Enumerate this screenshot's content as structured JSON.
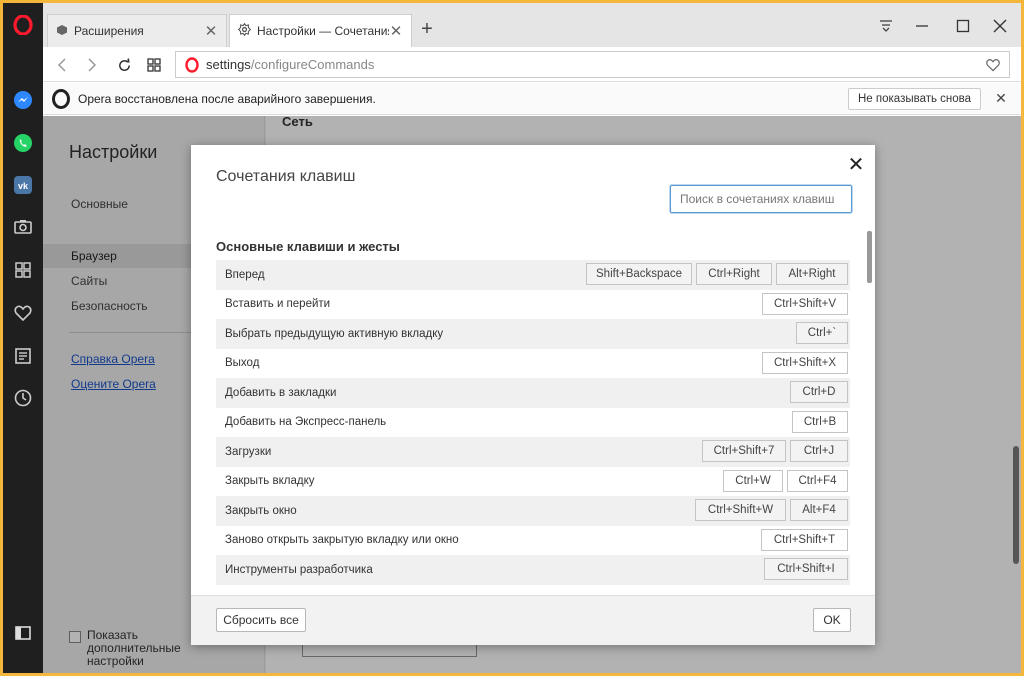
{
  "tabs": [
    {
      "label": "Расширения",
      "icon": "extensions-cube-icon",
      "active": false
    },
    {
      "label": "Настройки — Сочетания",
      "icon": "gear-icon",
      "active": true
    }
  ],
  "address": {
    "host": "settings",
    "path": "/configureCommands"
  },
  "infobar": {
    "text": "Opera восстановлена после аварийного завершения.",
    "dismiss_label": "Не показывать снова"
  },
  "settings": {
    "title": "Настройки",
    "nav": [
      "Основные",
      "Браузер",
      "Сайты",
      "Безопасность"
    ],
    "selected": "Браузер",
    "links": [
      "Справка Opera",
      "Оцените Opera"
    ],
    "advanced_label": "Показать дополнительные настройки",
    "section_network": "Сеть"
  },
  "dialog": {
    "title": "Сочетания клавиш",
    "search_placeholder": "Поиск в сочетаниях клавиш",
    "section": "Основные клавиши и жесты",
    "shortcuts": [
      {
        "action": "Вперед",
        "keys": [
          "Shift+Backspace",
          "Ctrl+Right",
          "Alt+Right"
        ]
      },
      {
        "action": "Вставить и перейти",
        "keys": [
          "Ctrl+Shift+V"
        ]
      },
      {
        "action": "Выбрать предыдущую активную вкладку",
        "keys": [
          "Ctrl+`"
        ]
      },
      {
        "action": "Выход",
        "keys": [
          "Ctrl+Shift+X"
        ]
      },
      {
        "action": "Добавить в закладки",
        "keys": [
          "Ctrl+D"
        ]
      },
      {
        "action": "Добавить на Экспресс-панель",
        "keys": [
          "Ctrl+B"
        ]
      },
      {
        "action": "Загрузки",
        "keys": [
          "Ctrl+Shift+7",
          "Ctrl+J"
        ]
      },
      {
        "action": "Закрыть вкладку",
        "keys": [
          "Ctrl+W",
          "Ctrl+F4"
        ]
      },
      {
        "action": "Закрыть окно",
        "keys": [
          "Ctrl+Shift+W",
          "Alt+F4"
        ]
      },
      {
        "action": "Заново открыть закрытую вкладку или окно",
        "keys": [
          "Ctrl+Shift+T"
        ]
      },
      {
        "action": "Инструменты разработчика",
        "keys": [
          "Ctrl+Shift+I"
        ]
      }
    ],
    "reset_label": "Сбросить все",
    "ok_label": "OK"
  },
  "colors": {
    "opera_red": "#ff1b2d",
    "sidebar_bg": "#1f1f1f",
    "frame": "#f4b73a",
    "link": "#1a55c9"
  }
}
